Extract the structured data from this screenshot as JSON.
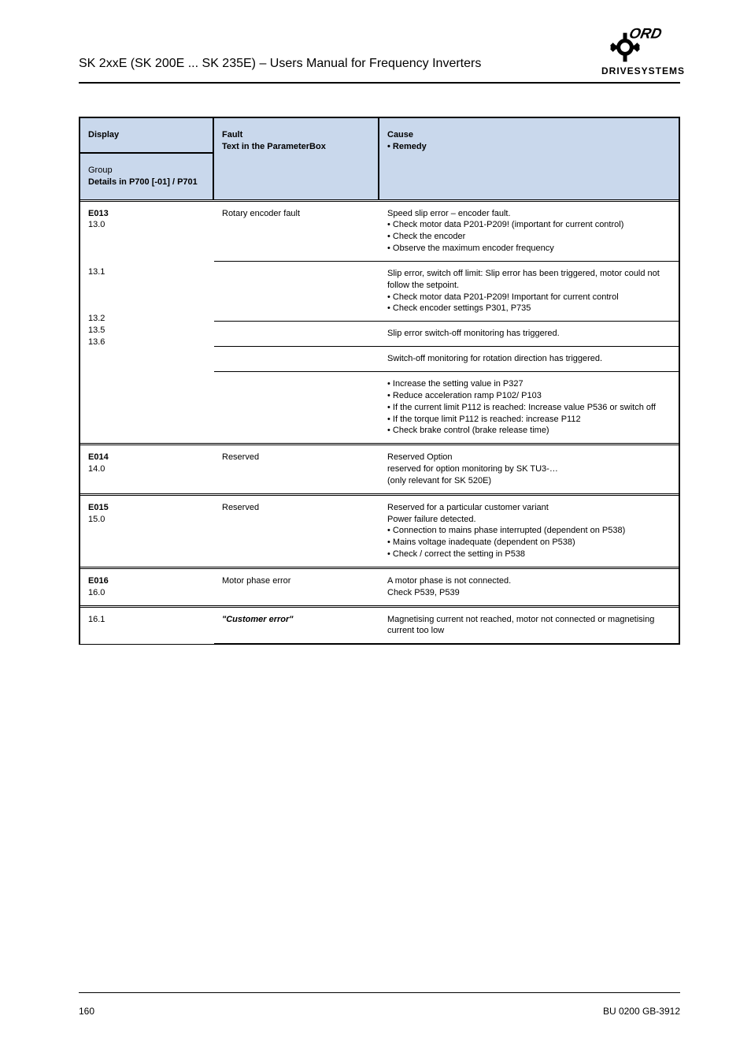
{
  "header": {
    "title": "SK 2xxE (SK 200E ... SK 235E) – Users Manual for Frequency Inverters"
  },
  "logo": {
    "name": "nord-gear-logo",
    "subtext": "DRIVESYSTEMS"
  },
  "table": {
    "head": {
      "a1": "Display",
      "a2_prefix": "Group",
      "a2_bold": "Details in P700 [-01] / P701",
      "b": "Fault\nText in the ParameterBox",
      "c": "Cause\n• Remedy"
    },
    "groups": [
      {
        "a_bold": "E013",
        "a_plain": "13.0",
        "rows": [
          {
            "b": "Rotary encoder fault",
            "c": "Speed slip error – encoder fault.\n• Check motor data P201-P209! (important for current control)\n• Check the encoder\n• Observe the maximum encoder frequency"
          },
          {
            "b": "",
            "c": "Slip error, switch off limit: Slip error has been triggered, motor could not follow the setpoint.\n• Check motor data P201-P209! Important for current control\n• Check encoder settings P301, P735"
          },
          {
            "b": "",
            "c": "Slip error switch-off monitoring has triggered."
          },
          {
            "b": "",
            "c": "Switch-off monitoring for rotation direction has triggered."
          },
          {
            "b": "",
            "c": "• Increase the setting value in P327\n• Reduce acceleration ramp P102/ P103\n• If the current limit P112 is reached: Increase value P536 or switch off\n• If the torque limit P112 is reached: increase P112\n• Check brake control (brake release time)"
          }
        ],
        "extra_a": [
          "13.1",
          "13.2",
          "13.5",
          "13.6"
        ]
      },
      {
        "a_bold": "E014",
        "a_plain": "14.0",
        "rows": [
          {
            "b": "Reserved",
            "c": "Reserved Option\nreserved for option monitoring by SK TU3-…\n(only relevant for SK 520E)"
          }
        ]
      },
      {
        "a_bold": "E015",
        "a_plain": "15.0",
        "rows": [
          {
            "b": "Reserved",
            "c": "Reserved for a particular customer variant\nPower failure detected.\n• Connection to mains phase interrupted (dependent on P538)\n• Mains voltage inadequate (dependent on P538)\n• Check / correct the setting in P538"
          }
        ]
      },
      {
        "a_bold": "E016",
        "a_plain": "16.0",
        "rows": [
          {
            "b": "Motor phase error",
            "c": "A motor phase is not connected.\nCheck P539, P539"
          }
        ],
        "last": true
      },
      {
        "a_bold": "",
        "a_plain": "16.1",
        "rows": [
          {
            "b": "\"Customer error\"",
            "c": "Magnetising current not reached, motor not connected or magnetising current too low"
          }
        ],
        "last": true
      }
    ]
  },
  "footer": {
    "left": "160",
    "right": "BU 0200 GB-3912"
  }
}
